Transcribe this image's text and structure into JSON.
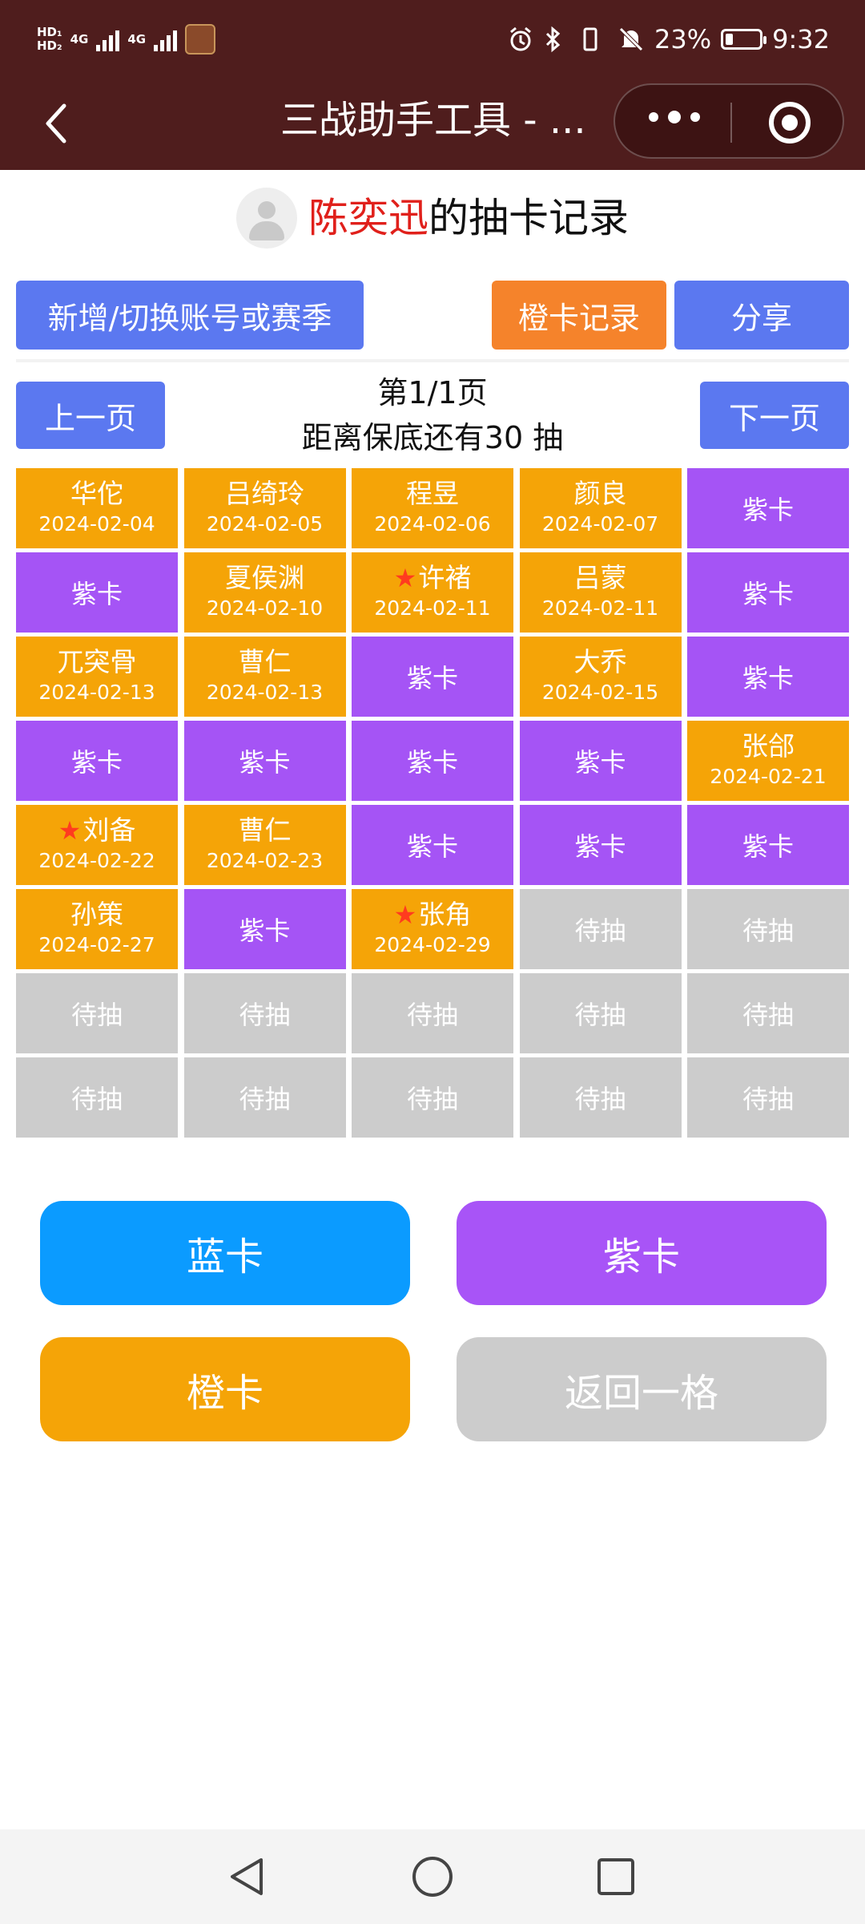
{
  "status_bar": {
    "hd1": "HD₁",
    "hd2": "HD₂",
    "net1": "4G",
    "net2": "4G",
    "battery": "23%",
    "time": "9:32",
    "battery_level": 0.23
  },
  "nav": {
    "title": "三战助手工具 - ...",
    "icons": [
      "back-chevron-icon",
      "more-dots-icon",
      "close-target-icon"
    ]
  },
  "header": {
    "name": "陈奕迅",
    "suffix": "的抽卡记录"
  },
  "toolbar": {
    "switch_account": "新增/切换账号或赛季",
    "orange_record": "橙卡记录",
    "share": "分享"
  },
  "pager": {
    "prev": "上一页",
    "next": "下一页",
    "page": "第1/1页",
    "pity": "距离保底还有30 抽"
  },
  "cells": [
    {
      "type": "orange",
      "name": "华佗",
      "date": "2024-02-04",
      "star": false
    },
    {
      "type": "orange",
      "name": "吕绮玲",
      "date": "2024-02-05",
      "star": false
    },
    {
      "type": "orange",
      "name": "程昱",
      "date": "2024-02-06",
      "star": false
    },
    {
      "type": "orange",
      "name": "颜良",
      "date": "2024-02-07",
      "star": false
    },
    {
      "type": "purple",
      "label": "紫卡"
    },
    {
      "type": "purple",
      "label": "紫卡"
    },
    {
      "type": "orange",
      "name": "夏侯渊",
      "date": "2024-02-10",
      "star": false
    },
    {
      "type": "orange",
      "name": "许褚",
      "date": "2024-02-11",
      "star": true
    },
    {
      "type": "orange",
      "name": "吕蒙",
      "date": "2024-02-11",
      "star": false
    },
    {
      "type": "purple",
      "label": "紫卡"
    },
    {
      "type": "orange",
      "name": "兀突骨",
      "date": "2024-02-13",
      "star": false
    },
    {
      "type": "orange",
      "name": "曹仁",
      "date": "2024-02-13",
      "star": false
    },
    {
      "type": "purple",
      "label": "紫卡"
    },
    {
      "type": "orange",
      "name": "大乔",
      "date": "2024-02-15",
      "star": false
    },
    {
      "type": "purple",
      "label": "紫卡"
    },
    {
      "type": "purple",
      "label": "紫卡"
    },
    {
      "type": "purple",
      "label": "紫卡"
    },
    {
      "type": "purple",
      "label": "紫卡"
    },
    {
      "type": "purple",
      "label": "紫卡"
    },
    {
      "type": "orange",
      "name": "张郃",
      "date": "2024-02-21",
      "star": false
    },
    {
      "type": "orange",
      "name": "刘备",
      "date": "2024-02-22",
      "star": true
    },
    {
      "type": "orange",
      "name": "曹仁",
      "date": "2024-02-23",
      "star": false
    },
    {
      "type": "purple",
      "label": "紫卡"
    },
    {
      "type": "purple",
      "label": "紫卡"
    },
    {
      "type": "purple",
      "label": "紫卡"
    },
    {
      "type": "orange",
      "name": "孙策",
      "date": "2024-02-27",
      "star": false
    },
    {
      "type": "purple",
      "label": "紫卡"
    },
    {
      "type": "orange",
      "name": "张角",
      "date": "2024-02-29",
      "star": true
    },
    {
      "type": "gray",
      "label": "待抽"
    },
    {
      "type": "gray",
      "label": "待抽"
    },
    {
      "type": "gray",
      "label": "待抽"
    },
    {
      "type": "gray",
      "label": "待抽"
    },
    {
      "type": "gray",
      "label": "待抽"
    },
    {
      "type": "gray",
      "label": "待抽"
    },
    {
      "type": "gray",
      "label": "待抽"
    },
    {
      "type": "gray",
      "label": "待抽"
    },
    {
      "type": "gray",
      "label": "待抽"
    },
    {
      "type": "gray",
      "label": "待抽"
    },
    {
      "type": "gray",
      "label": "待抽"
    },
    {
      "type": "gray",
      "label": "待抽"
    }
  ],
  "actions": {
    "blue": "蓝卡",
    "purple": "紫卡",
    "orange": "橙卡",
    "undo": "返回一格"
  },
  "colors": {
    "topbar": "#4f1d1d",
    "orange_cell": "#f5a407",
    "purple_cell": "#a554f5",
    "gray_cell": "#cccccc",
    "blue_button": "#5b78f0",
    "name_red": "#e0201b"
  }
}
